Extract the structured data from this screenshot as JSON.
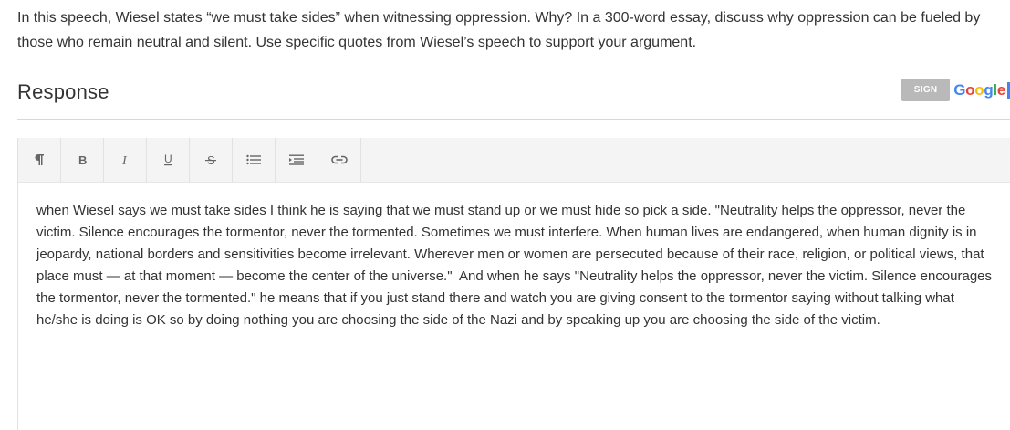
{
  "prompt": {
    "text": "In this speech, Wiesel states “we must take sides” when witnessing oppression. Why? In a 300-word essay, discuss why oppression can be fueled by those who remain neutral and silent. Use specific quotes from Wiesel’s speech to support your argument."
  },
  "response": {
    "heading": "Response",
    "signin_label": "SIGN IN",
    "google_logo_text": [
      "G",
      "o",
      "o",
      "g",
      "l",
      "e"
    ]
  },
  "toolbar": {
    "buttons": [
      {
        "name": "paragraph-button",
        "icon": "paragraph-icon"
      },
      {
        "name": "bold-button",
        "icon": "bold-icon"
      },
      {
        "name": "italic-button",
        "icon": "italic-icon"
      },
      {
        "name": "underline-button",
        "icon": "underline-icon"
      },
      {
        "name": "strikethrough-button",
        "icon": "strikethrough-icon"
      },
      {
        "name": "bullet-list-button",
        "icon": "bullet-list-icon"
      },
      {
        "name": "indent-button",
        "icon": "indent-icon"
      },
      {
        "name": "link-button",
        "icon": "link-icon"
      }
    ]
  },
  "editor": {
    "body": "when Wiesel says we must take sides I think he is saying that we must stand up or we must hide so pick a side. \"Neutrality helps the oppressor, never the victim. Silence encourages the tormentor, never the tormented. Sometimes we must interfere. When human lives are endangered, when human dignity is in jeopardy, national borders and sensitivities become irrelevant. Wherever men or women are persecuted because of their race, religion, or political views, that place must — at that moment — become the center of the universe.\"  And when he says \"Neutrality helps the oppressor, never the victim. Silence encourages the tormentor, never the tormented.\" he means that if you just stand there and watch you are giving consent to the tormentor saying without talking what he/she is doing is OK so by doing nothing you are choosing the side of the Nazi and by speaking up you are choosing the side of the victim."
  },
  "colors": {
    "signin_bg": "#b9b9b9",
    "toolbar_bg": "#f4f4f4",
    "google_blue": "#4285f4",
    "google_red": "#ea4335",
    "google_yellow": "#fbbc05",
    "google_green": "#34a853"
  }
}
